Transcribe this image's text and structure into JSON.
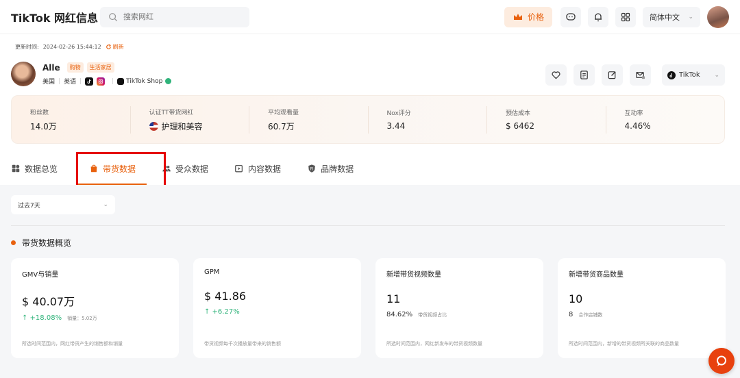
{
  "header": {
    "title": "TikTok 网红信息",
    "search_placeholder": "搜索网红",
    "price_label": "价格",
    "language": "简体中文"
  },
  "updated": {
    "label": "更新时间:",
    "time": "2024-02-26 15:44:12",
    "refresh_label": "刷新"
  },
  "profile": {
    "name": "Alle",
    "tags": [
      "购物",
      "生活家居"
    ],
    "country": "美国",
    "language": "英语",
    "shop_label": "TikTok Shop"
  },
  "actions": {
    "platform": "TikTok"
  },
  "stats": [
    {
      "label": "粉丝数",
      "value": "14.0万"
    },
    {
      "label": "认证TT带货网红",
      "value": "护理和美容"
    },
    {
      "label": "平均观看量",
      "value": "60.7万"
    },
    {
      "label": "Nox评分",
      "value": "3.44"
    },
    {
      "label": "预估成本",
      "value": "$ 6462"
    },
    {
      "label": "互动率",
      "value": "4.46%"
    }
  ],
  "tabs": [
    {
      "label": "数据总览",
      "active": false
    },
    {
      "label": "带货数据",
      "active": true
    },
    {
      "label": "受众数据",
      "active": false
    },
    {
      "label": "内容数据",
      "active": false
    },
    {
      "label": "品牌数据",
      "active": false
    }
  ],
  "filter": {
    "period": "过去7天"
  },
  "section": {
    "title": "带货数据概览"
  },
  "cards": [
    {
      "title": "GMV与销量",
      "value": "$ 40.07万",
      "sub_main": "↑ +18.08%",
      "sub_note": "销量：5.02万",
      "foot": "所选时间范围内，网红带货产生的销售额和销量"
    },
    {
      "title": "GPM",
      "value": "$ 41.86",
      "sub_main": "↑ +6.27%",
      "sub_note": "",
      "foot": "带货视频每千次播放量带来的销售额"
    },
    {
      "title": "新增带货视频数量",
      "value": "11",
      "sub_main": "84.62%",
      "sub_note": "带货视频占比",
      "foot": "所选时间范围内，网红新发布的带货视频数量"
    },
    {
      "title": "新增带货商品数量",
      "value": "10",
      "sub_main": "8",
      "sub_note": "合作店铺数",
      "foot": "所选时间范围内，新增的带货视频所关联的商品数量"
    }
  ],
  "colors": {
    "accent": "#e8610e",
    "up": "#2fb37a",
    "highlight": "#e50000"
  }
}
